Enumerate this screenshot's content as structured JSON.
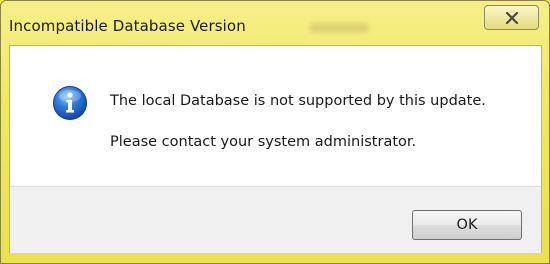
{
  "dialog": {
    "title": "Incompatible Database Version",
    "close_icon": "close-icon",
    "info_icon": "info-icon",
    "message_line1": "The local Database is not supported by this update.",
    "message_line2": "Please contact your system administrator.",
    "ok_label": "OK"
  },
  "colors": {
    "titlebar": "#f2e85e",
    "content_background": "#ffffff",
    "button_area_background": "#f0f0f0",
    "info_icon_blue": "#1f5fbf"
  }
}
